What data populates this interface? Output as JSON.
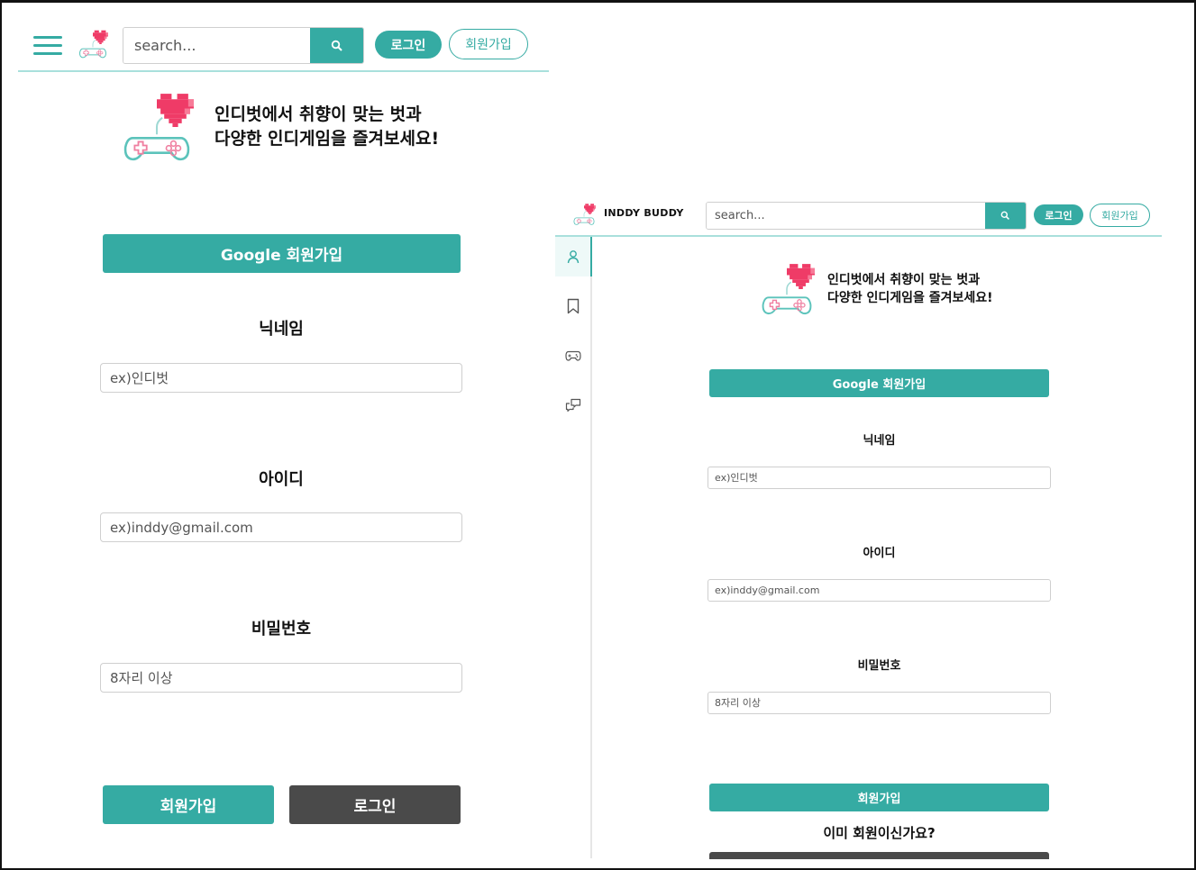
{
  "colors": {
    "accent": "#35aba3",
    "accent_light": "#a9e0dc",
    "dark_button": "#4a4a4a",
    "heart": "#ef3b67"
  },
  "mobile": {
    "search_placeholder": "search...",
    "login_label": "로그인",
    "signup_label": "회원가입",
    "tagline_line1": "인디벗에서 취향이 맞는 벗과",
    "tagline_line2": "다양한 인디게임을 즐겨보세요!",
    "google_signup": "Google 회원가입",
    "nickname_label": "닉네임",
    "nickname_placeholder": "ex)인디벗",
    "id_label": "아이디",
    "id_placeholder": "ex)inddy@gmail.com",
    "password_label": "비밀번호",
    "password_placeholder": "8자리 이상",
    "submit_signup": "회원가입",
    "submit_login": "로그인"
  },
  "desktop": {
    "brand": "INDDY BUDDY",
    "search_placeholder": "search...",
    "login_label": "로그인",
    "signup_label": "회원가입",
    "sidebar_icons": [
      "user-icon",
      "bookmark-icon",
      "gamepad-icon",
      "chat-icon"
    ],
    "tagline_line1": "인디벗에서 취향이 맞는 벗과",
    "tagline_line2": "다양한 인디게임을 즐겨보세요!",
    "google_signup": "Google 회원가입",
    "nickname_label": "닉네임",
    "nickname_placeholder": "ex)인디벗",
    "id_label": "아이디",
    "id_placeholder": "ex)inddy@gmail.com",
    "password_label": "비밀번호",
    "password_placeholder": "8자리 이상",
    "submit_signup": "회원가입",
    "already_member": "이미 회원이신가요?"
  }
}
